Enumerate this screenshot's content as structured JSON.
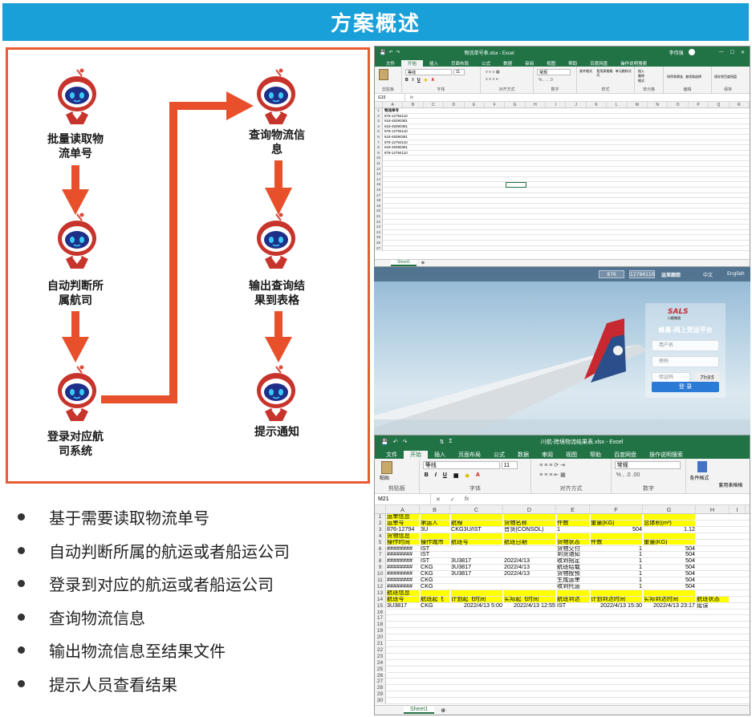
{
  "banner": {
    "title": "方案概述"
  },
  "flow": {
    "steps": [
      {
        "label_line1": "批量读取物",
        "label_line2": "流单号"
      },
      {
        "label_line1": "自动判断所",
        "label_line2": "属航司"
      },
      {
        "label_line1": "登录对应航",
        "label_line2": "司系统"
      },
      {
        "label_line1": "查询物流信",
        "label_line2": "息"
      },
      {
        "label_line1": "输出查询结",
        "label_line2": "果到表格"
      },
      {
        "label_line1": "提示通知",
        "label_line2": ""
      }
    ]
  },
  "bullets": [
    "基于需要读取物流单号",
    "自动判断所属的航运或者船运公司",
    "登录到对应的航运或者船运公司",
    "查询物流信息",
    "输出物流信息至结果文件",
    "提示人员查看结果"
  ],
  "excel1": {
    "title": "物流单号表.xlsx - Excel",
    "user": "李伟强",
    "tabs": [
      "文件",
      "开始",
      "插入",
      "页面布局",
      "公式",
      "数据",
      "审阅",
      "视图",
      "帮助",
      "百度网盘",
      "操作说明搜索"
    ],
    "share": "共享",
    "font_name": "等线",
    "font_size": "11",
    "number_format": "常规",
    "ribbon_groups": [
      "剪贴板",
      "字体",
      "对齐方式",
      "数字",
      "样式",
      "单元格",
      "编辑",
      "保存"
    ],
    "ribbon_buttons": [
      "条件格式",
      "套用表格格式",
      "单元格样式",
      "插入",
      "删除",
      "格式",
      "排序和筛选",
      "查找和选择",
      "保存到百度网盘"
    ],
    "name_box": "G15",
    "columns": [
      "A",
      "B",
      "C",
      "D",
      "E",
      "F",
      "G",
      "H",
      "I",
      "J",
      "K",
      "L",
      "M",
      "N",
      "O",
      "P",
      "Q",
      "R"
    ],
    "rows": [
      "物流单号",
      "876-12794110",
      "618-48390381",
      "618-48390381",
      "876-12794110",
      "618-48390381",
      "876-12794110",
      "618-48390381",
      "876-12794110"
    ],
    "sheet": "Sheet1"
  },
  "login": {
    "prefix": "876",
    "number": "12794110",
    "track": "运单跟踪",
    "lang_cn": "中文",
    "lang_en": "English",
    "brand": "SALS",
    "brand_sub": "川航物流",
    "platform": "蜂巢-网上货运平台",
    "username_placeholder": "用户名",
    "password_placeholder": "密码",
    "captcha_placeholder": "验证码",
    "captcha_text": "7h95",
    "login_button": "登 录"
  },
  "excel2": {
    "title": "川航-跨境物流结果表.xlsx - Excel",
    "tabs": [
      "文件",
      "开始",
      "插入",
      "页面布局",
      "公式",
      "数据",
      "审阅",
      "视图",
      "帮助",
      "百度网盘",
      "操作说明搜索"
    ],
    "font_name": "等线",
    "font_size": "11",
    "number_format": "常规",
    "paste": "粘贴",
    "ribbon_groups": [
      "剪贴板",
      "字体",
      "对齐方式",
      "数字"
    ],
    "cond_format": "条件格式",
    "table_format": "套用表格格",
    "name_box": "M21",
    "columns": [
      "A",
      "B",
      "C",
      "D",
      "E",
      "F",
      "G",
      "H",
      "I"
    ],
    "rows": [
      {
        "n": "1",
        "hl": true,
        "cells": [
          "运单信息",
          "",
          "",
          "",
          "",
          "",
          "",
          ""
        ]
      },
      {
        "n": "2",
        "hl": true,
        "cells": [
          "运单号",
          "承运人",
          "航程",
          "货物名称",
          "件数",
          "重量(KG)",
          "总体积(m³)",
          ""
        ]
      },
      {
        "n": "3",
        "hl": false,
        "cells": [
          "876-12794",
          "3U",
          "CKG3U/IST",
          "普货(CONSOL)",
          "1",
          "504",
          "1.12",
          ""
        ]
      },
      {
        "n": "4",
        "hl": true,
        "cells": [
          "货物信息",
          "",
          "",
          "",
          "",
          "",
          "",
          ""
        ]
      },
      {
        "n": "5",
        "hl": true,
        "cells": [
          "操作时间",
          "操作城市",
          "航班号",
          "航班日期",
          "货物状态",
          "件数",
          "重量(KG)",
          ""
        ]
      },
      {
        "n": "6",
        "hl": false,
        "cells": [
          "########",
          "IST",
          "",
          "",
          "货物交付",
          "1",
          "504",
          ""
        ]
      },
      {
        "n": "7",
        "hl": false,
        "cells": [
          "########",
          "IST",
          "",
          "",
          "到货通知",
          "1",
          "504",
          ""
        ]
      },
      {
        "n": "8",
        "hl": false,
        "cells": [
          "########",
          "IST",
          "3U3817",
          "2022/4/13",
          "收到指定",
          "1",
          "504",
          ""
        ]
      },
      {
        "n": "9",
        "hl": false,
        "cells": [
          "########",
          "CKG",
          "3U3817",
          "2022/4/13",
          "航班结载",
          "1",
          "504",
          ""
        ]
      },
      {
        "n": "10",
        "hl": false,
        "cells": [
          "########",
          "CKG",
          "3U3817",
          "2022/4/13",
          "货物按预",
          "1",
          "504",
          ""
        ]
      },
      {
        "n": "11",
        "hl": false,
        "cells": [
          "########",
          "CKG",
          "",
          "",
          "生成运单",
          "1",
          "504",
          ""
        ]
      },
      {
        "n": "12",
        "hl": false,
        "cells": [
          "########",
          "CKG",
          "",
          "",
          "收到托运",
          "1",
          "504",
          ""
        ]
      },
      {
        "n": "13",
        "hl": true,
        "cells": [
          "航班信息",
          "",
          "",
          "",
          "",
          "",
          "",
          ""
        ]
      },
      {
        "n": "14",
        "hl": true,
        "cells": [
          "航班号",
          "航班起飞",
          "计划起飞时间",
          "实际起飞时间",
          "航班到达",
          "计划到达时间",
          "实际到达时间",
          "航班状态"
        ]
      },
      {
        "n": "15",
        "hl": false,
        "cells": [
          "3U3817",
          "CKG",
          "2022/4/13 5:00",
          "2022/4/13 12:55",
          "IST",
          "2022/4/13 15:30",
          "2022/4/13 23:17",
          "延误"
        ]
      }
    ],
    "empty_rows": [
      "16",
      "17",
      "18",
      "19",
      "20",
      "21",
      "22",
      "23",
      "24",
      "25",
      "26",
      "27",
      "28",
      "29",
      "30"
    ],
    "sheet": "Sheet1"
  },
  "colors": {
    "banner": "#1aa0d8",
    "flow_border": "#e85c33",
    "arrow": "#e8502b",
    "excel_green": "#217346",
    "highlight": "#ffff00"
  }
}
